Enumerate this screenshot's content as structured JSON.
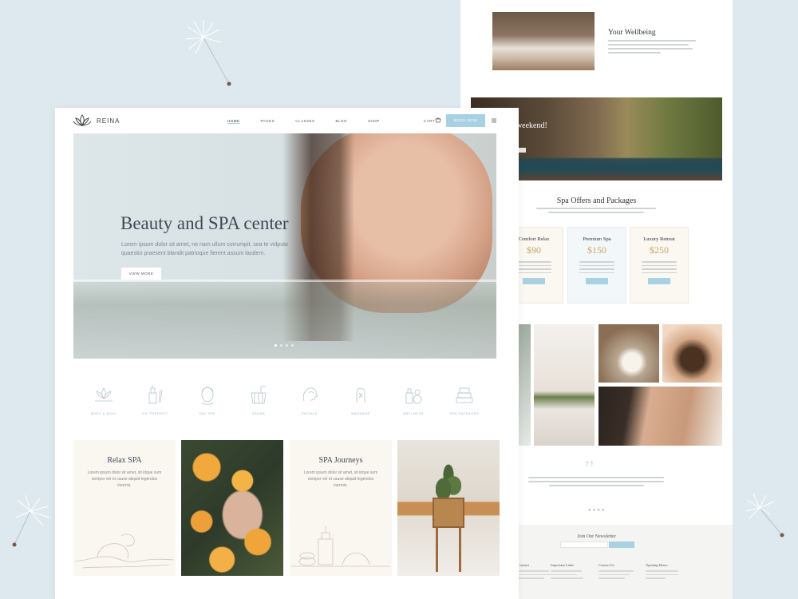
{
  "main_page": {
    "brand": "REINA",
    "nav": [
      "HOME",
      "PAGES",
      "CLASSES",
      "BLOG",
      "SHOP"
    ],
    "cart_label": "CART",
    "book_label": "BOOK NOW",
    "hero": {
      "title": "Beauty and SPA center",
      "text": "Lorem ipsum dolor sit amet, ne nam ullum corrumpit, sea te volputa quaestio praesent blandit patrioque fierent assum laudem.",
      "button": "VIEW MORE"
    },
    "services": [
      "BODY & SOUL",
      "OIL THERAPY",
      "DAY SPA",
      "SAUNA",
      "FACIALS",
      "MASSAGE",
      "WELLNESS",
      "SPA PACKAGES"
    ],
    "cards": [
      {
        "title": "Relax SPA",
        "text": "Lorem ipsum dolor sit amet, sit idque sum semper vel et cause aliquid legendos inermis."
      },
      {
        "title": "SPA Journeys",
        "text": "Lorem ipsum dolor sit amet, sit idque sum semper vel et cause aliquid legendos inermis."
      }
    ]
  },
  "back_page": {
    "wellbeing_title": "Your Wellbeing",
    "pool_text": "pa weekend!",
    "offers_title": "Spa Offers and Packages",
    "offers": [
      {
        "name": "Comfort Relax",
        "price": "$90"
      },
      {
        "name": "Premium Spa",
        "price": "$150"
      },
      {
        "name": "Luxury Retreat",
        "price": "$250"
      }
    ],
    "newsletter_title": "Join Our Newsletter",
    "footer_columns": [
      "Contact",
      "Important Links",
      "Contact Us",
      "Opening Hours"
    ]
  },
  "colors": {
    "accent": "#a8d1e3",
    "gold": "#c9a46a",
    "background": "#dde8ef"
  }
}
